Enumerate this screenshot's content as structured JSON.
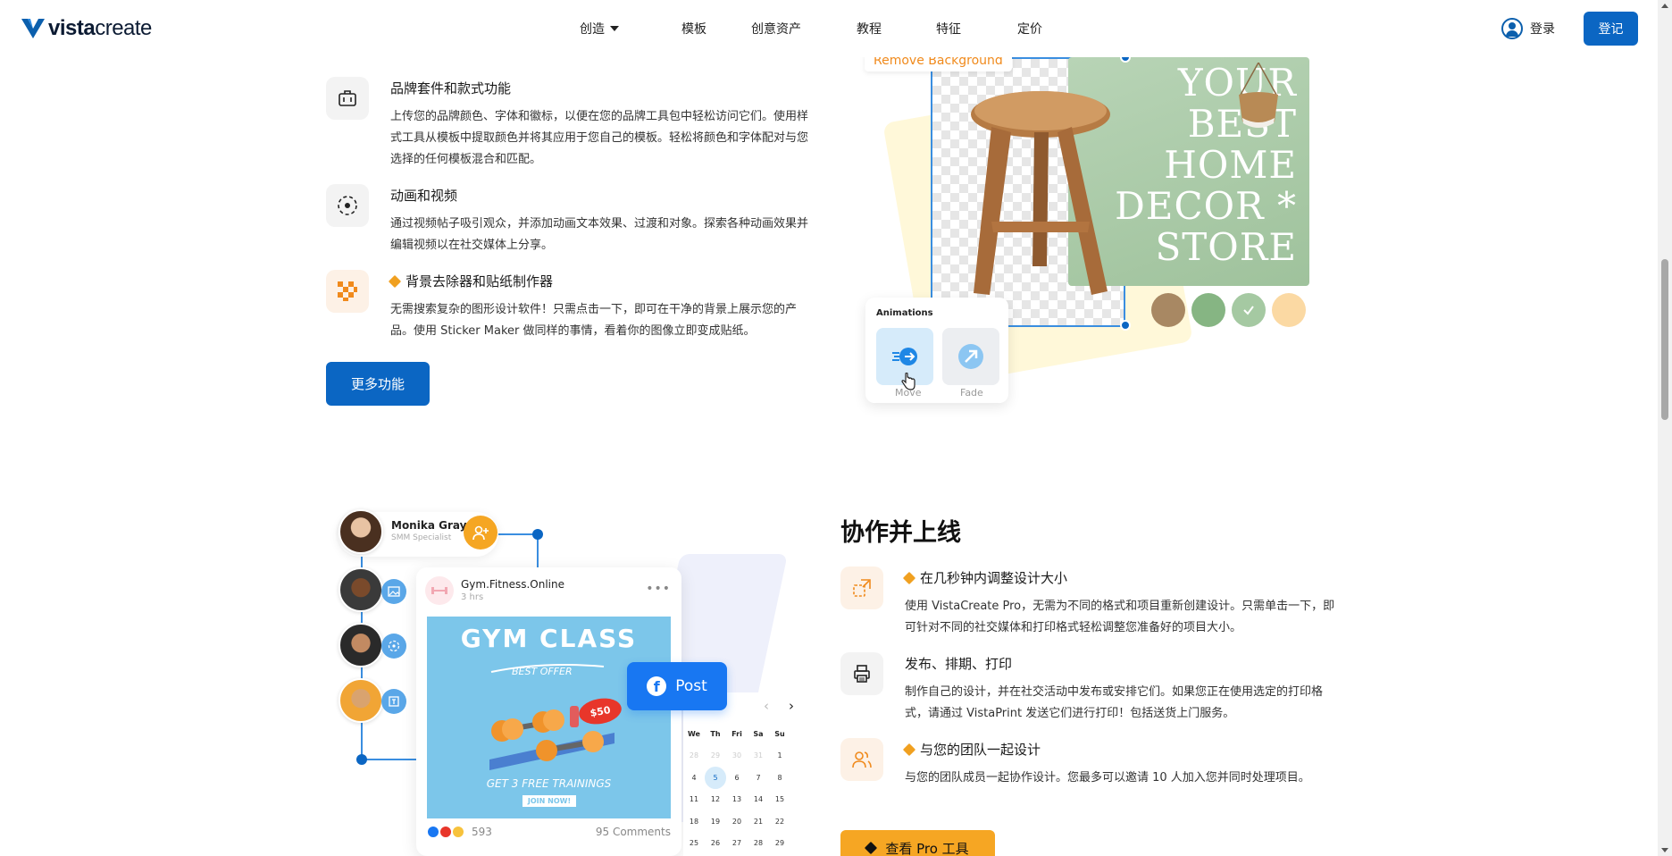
{
  "header": {
    "logo_text_bold": "vista",
    "logo_text_light": "create",
    "nav": [
      "创造",
      "模板",
      "创意资产",
      "教程",
      "特征",
      "定价"
    ],
    "login_label": "登录",
    "signup_label": "登记"
  },
  "features_top": [
    {
      "icon": "briefcase-icon",
      "title": "品牌套件和款式功能",
      "pro": false,
      "desc": "上传您的品牌颜色、字体和徽标，以便在您的品牌工具包中轻松访问它们。使用样式工具从模板中提取颜色并将其应用于您自己的模板。轻松将颜色和字体配对与您选择的任何模板混合和匹配。"
    },
    {
      "icon": "play-circle-icon",
      "title": "动画和视频",
      "pro": false,
      "desc": "通过视频帖子吸引观众，并添加动画文本效果、过渡和对象。探索各种动画效果并编辑视频以在社交媒体上分享。"
    },
    {
      "icon": "checker-icon",
      "title": "背景去除器和贴纸制作器",
      "pro": true,
      "desc": "无需搜索复杂的图形设计软件！只需点击一下，即可在干净的背景上展示您的产品。使用 Sticker Maker 做同样的事情，看着你的图像立即变成贴纸。"
    }
  ],
  "more_button": "更多功能",
  "illustration_top": {
    "remove_bg_label": "Remove Background",
    "poster_text": [
      "YOUR",
      "BEST",
      "HOME",
      "DECOR *",
      "STORE"
    ],
    "animations_title": "Animations",
    "anim_move": "Move",
    "anim_fade": "Fade",
    "swatches": [
      "#a88863",
      "#86b583",
      "#a5c9a2",
      "#fbd9a3"
    ]
  },
  "section2": {
    "title": "协作并上线",
    "features": [
      {
        "icon": "resize-icon",
        "title": "在几秒钟内调整设计大小",
        "pro": true,
        "desc": "使用 VistaCreate Pro，无需为不同的格式和项目重新创建设计。只需单击一下，即可针对不同的社交媒体和打印格式轻松调整您准备好的项目大小。"
      },
      {
        "icon": "printer-icon",
        "title": "发布、排期、打印",
        "pro": false,
        "desc": "制作自己的设计，并在社交活动中发布或安排它们。如果您正在使用选定的打印格式，请通过 VistaPrint 发送它们进行打印！包括送货上门服务。"
      },
      {
        "icon": "team-icon",
        "title": "与您的团队一起设计",
        "pro": true,
        "desc": "与您的团队成员一起协作设计。您最多可以邀请 10 人加入您并同时处理项目。"
      }
    ],
    "pro_button": "查看 Pro 工具"
  },
  "illustration_bottom": {
    "person_name": "Monika Gray",
    "person_role": "SMM Specialist",
    "post_account": "Gym.Fitness.Online",
    "post_time": "3 hrs",
    "gym_title": "GYM CLASS",
    "gym_offer": "BEST OFFER",
    "gym_price": "$50",
    "gym_free": "GET 3 FREE TRAININGS",
    "gym_join": "JOIN NOW!",
    "likes": "593",
    "comments": "95 Comments",
    "fb_label": "Post",
    "calendar_heads": [
      "We",
      "Th",
      "Fri",
      "Sa",
      "Su"
    ],
    "calendar_rows": [
      [
        "28",
        "29",
        "30",
        "31",
        "1"
      ],
      [
        "4",
        "5",
        "6",
        "7",
        "8"
      ],
      [
        "11",
        "12",
        "13",
        "14",
        "15"
      ],
      [
        "18",
        "19",
        "20",
        "21",
        "22"
      ],
      [
        "25",
        "26",
        "27",
        "28",
        "29"
      ]
    ],
    "calendar_selected": "5"
  },
  "colors": {
    "brand_blue": "#0b66c3",
    "pro_orange": "#f6a623",
    "facebook": "#1877f2"
  }
}
